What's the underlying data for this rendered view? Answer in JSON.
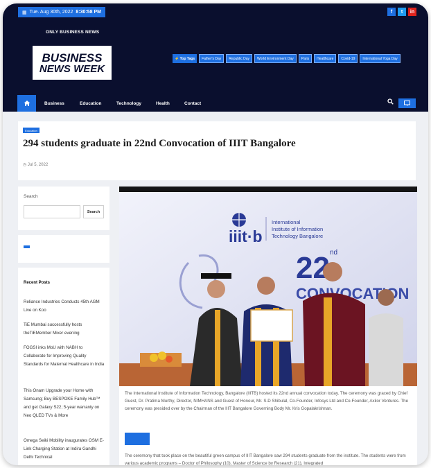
{
  "topbar": {
    "date": "Tue. Aug 30th, 2022",
    "time": "8:30:58 PM",
    "social": [
      {
        "icon": "facebook-icon",
        "glyph": "f",
        "color": "#1e6fe0"
      },
      {
        "icon": "twitter-icon",
        "glyph": "t",
        "color": "#1e9bf0"
      },
      {
        "icon": "linkedin-icon",
        "glyph": "in",
        "color": "#e0241e"
      }
    ]
  },
  "header": {
    "tagline": "ONLY BUSINESS NEWS",
    "logo_line1": "BUSINESS",
    "logo_line2": "NEWS WEEK",
    "top_tags_label": "Top Tags",
    "tags": [
      "Father's Day",
      "Republic Day",
      "World Environment Day",
      "Paris",
      "Healthcare",
      "Covid-19",
      "International Yoga Day"
    ]
  },
  "nav": {
    "items": [
      "Business",
      "Education",
      "Technology",
      "Health",
      "Contact"
    ]
  },
  "article": {
    "category": "Education",
    "title": "294 students graduate in 22nd Convocation of IIIT Bangalore",
    "date": "Jul 5, 2022",
    "photo": {
      "logo_text": "iiit·b",
      "institute": [
        "International",
        "Institute of Information",
        "Technology Bangalore"
      ],
      "big_number": "22",
      "ordinal": "nd",
      "banner": "CONVOCATION"
    },
    "caption": "The International Institute of Information Technology, Bangalore (IIITB) hosted its 22nd annual convocation today. The ceremony was graced by Chief Guest, Dr. Pratima Murthy, Director, NIMHANS and Guest of Honour, Mr. S.D Shibulal, Co-Founder, Infosys Ltd and Co-Founder, Axilor Ventures. The ceremony was presided over by the Chairman of the IIIT Bangalore Governing Body Mr. Kris Gopalakrishnan.",
    "body": "The ceremony that took place on the beautiful green campus of IIIT Bangalore saw 294 students graduate from the institute. The students were from various academic programs – Doctor of Philosophy (10), Master of Science by Research (21), Integrated"
  },
  "sidebar": {
    "search_label": "Search",
    "search_placeholder": "",
    "search_button": "Search",
    "recent_title": "Recent Posts",
    "recent_posts": [
      "Reliance Industries Conducts 45th AGM Live on Koo",
      "TiE Mumbai successfully hosts theTiEMember Mixer evening",
      "FOGSI inks MoU with NABH to Collaborate for Improving Quality Standards for Maternal Healthcare in India",
      "This Onam Upgrade your Home with Samsung; Buy BESPOKE Family Hub™ and get Galaxy S22; 5-year warranty on Neo QLED TVs & More",
      "Omega Seiki Mobility inaugurates OSM E-Link Charging Station at Indira Gandhi Delhi Technical"
    ]
  },
  "colors": {
    "navy": "#0a0f2e",
    "accent": "#1e6fe0"
  }
}
